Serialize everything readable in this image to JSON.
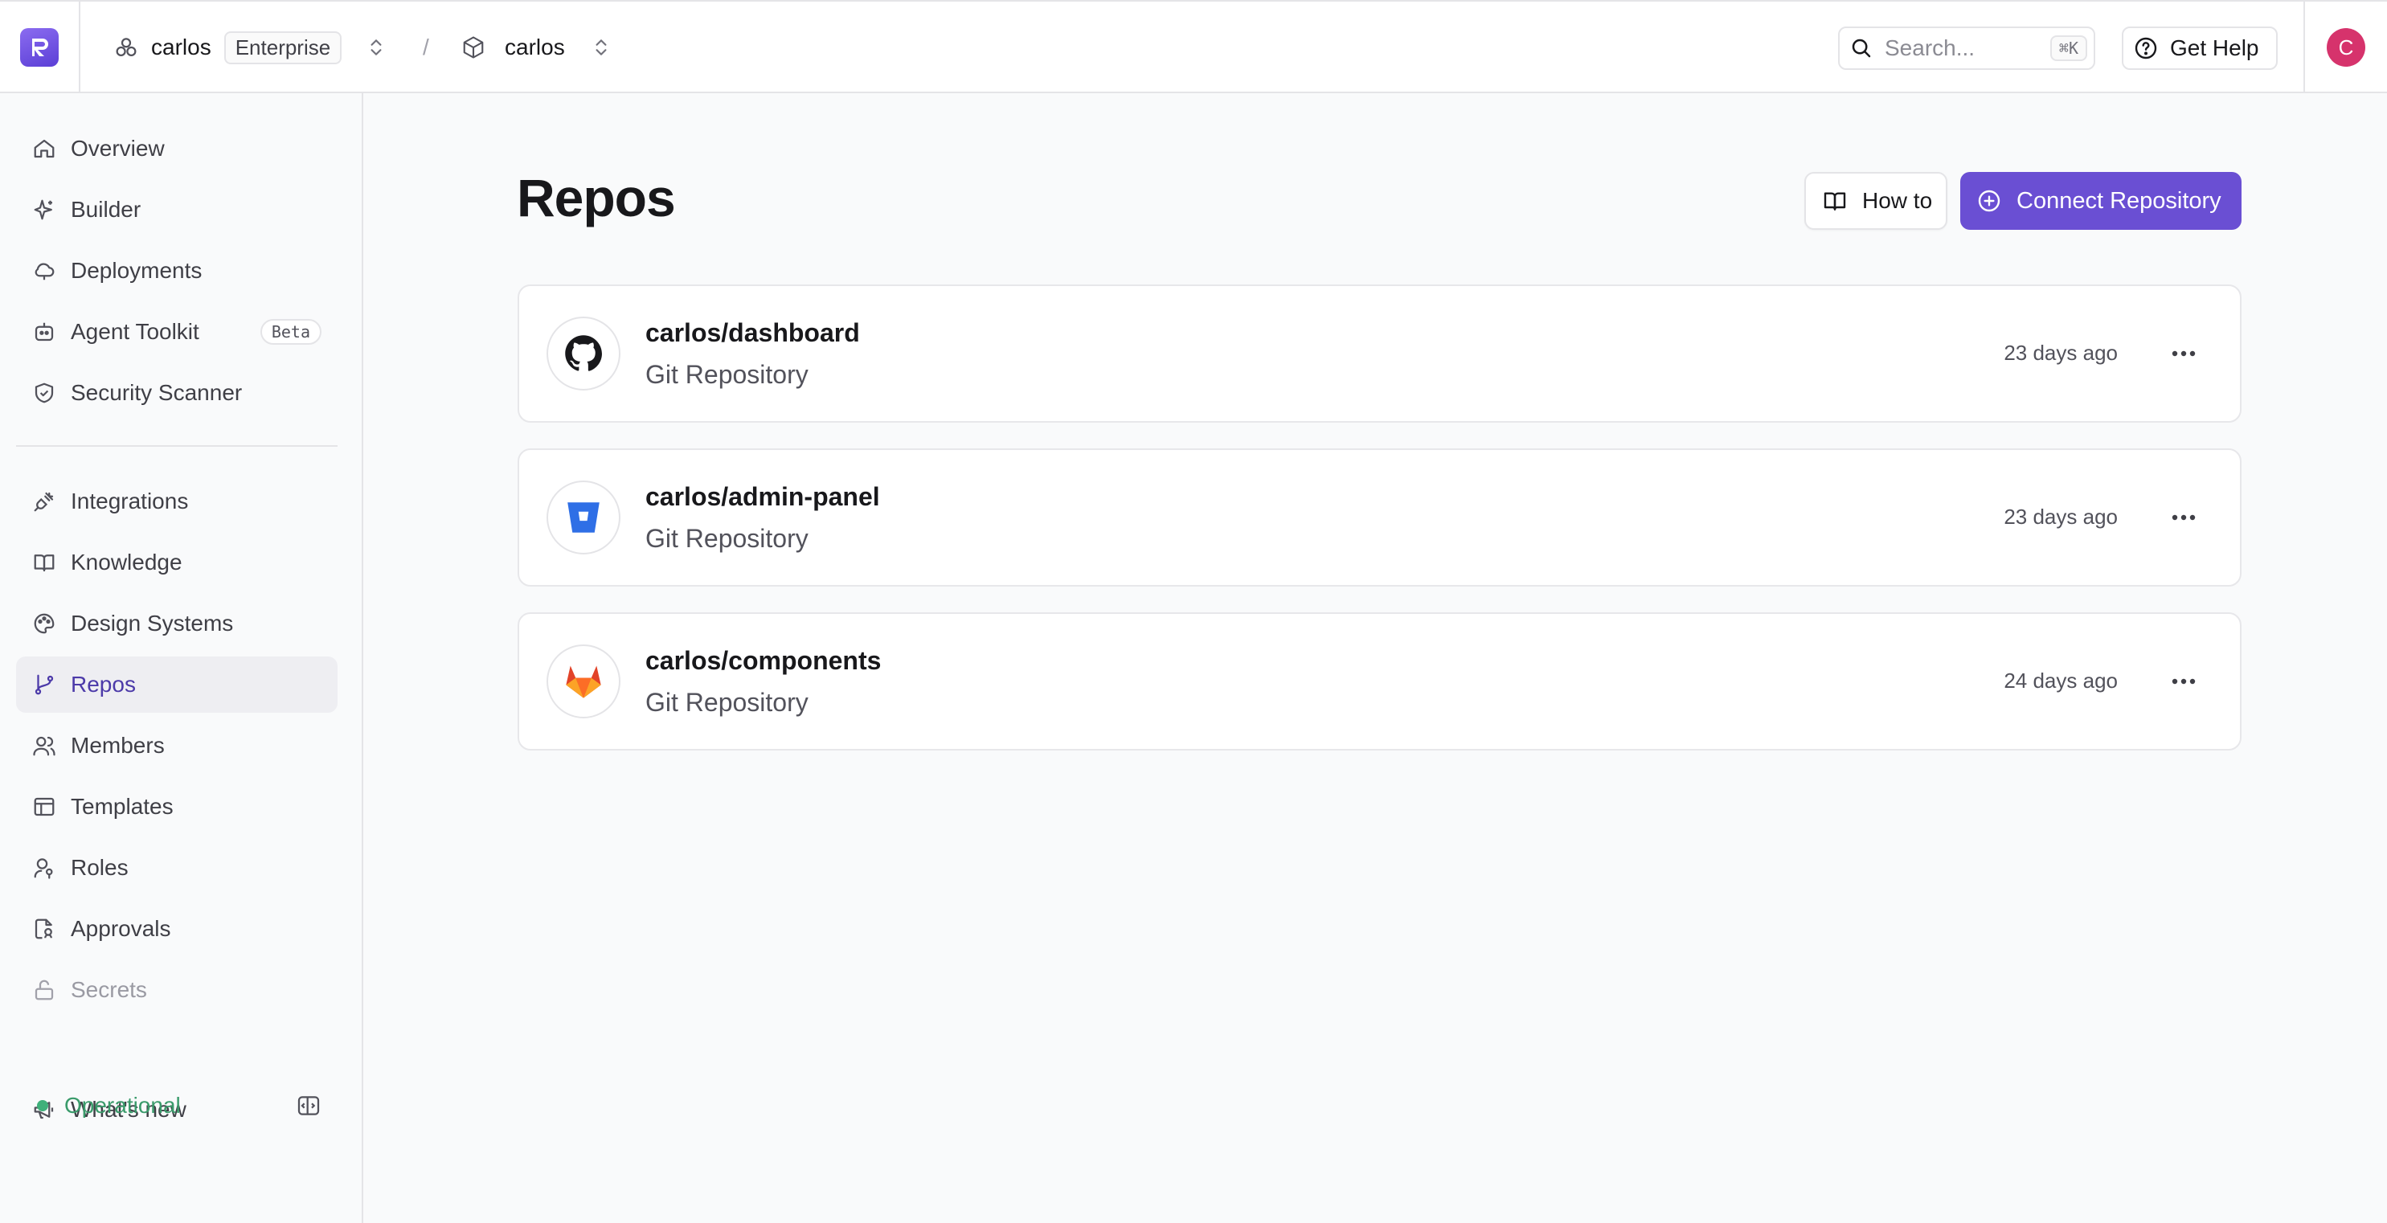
{
  "topbar": {
    "org_name": "carlos",
    "org_plan": "Enterprise",
    "separator": "/",
    "project_name": "carlos",
    "search_placeholder": "Search...",
    "search_shortcut": "⌘K",
    "help_label": "Get Help",
    "avatar_initial": "C"
  },
  "sidebar": {
    "items": [
      {
        "label": "Overview",
        "icon": "home-icon"
      },
      {
        "label": "Builder",
        "icon": "sparkle-icon"
      },
      {
        "label": "Deployments",
        "icon": "cloud-icon"
      },
      {
        "label": "Agent Toolkit",
        "icon": "agent-icon",
        "badge": "Beta"
      },
      {
        "label": "Security Scanner",
        "icon": "shield-icon"
      },
      {
        "label": "Integrations",
        "icon": "plug-icon"
      },
      {
        "label": "Knowledge",
        "icon": "book-icon"
      },
      {
        "label": "Design Systems",
        "icon": "palette-icon"
      },
      {
        "label": "Repos",
        "icon": "git-branch-icon",
        "active": true
      },
      {
        "label": "Members",
        "icon": "users-icon"
      },
      {
        "label": "Templates",
        "icon": "template-icon"
      },
      {
        "label": "Roles",
        "icon": "user-key-icon"
      },
      {
        "label": "Approvals",
        "icon": "approval-icon"
      },
      {
        "label": "Secrets",
        "icon": "lock-icon",
        "muted": true
      }
    ],
    "whats_new": "What's new",
    "status": "Operational"
  },
  "main": {
    "title": "Repos",
    "howto_label": "How to",
    "connect_label": "Connect Repository",
    "repos": [
      {
        "name": "carlos/dashboard",
        "type": "Git Repository",
        "updated": "23 days ago",
        "provider": "github-icon"
      },
      {
        "name": "carlos/admin-panel",
        "type": "Git Repository",
        "updated": "23 days ago",
        "provider": "bitbucket-icon"
      },
      {
        "name": "carlos/components",
        "type": "Git Repository",
        "updated": "24 days ago",
        "provider": "gitlab-icon"
      }
    ]
  },
  "colors": {
    "accent": "#6a4fd3",
    "active_text": "#4c3aa9",
    "status_green": "#3a9b6b",
    "avatar": "#d6336c"
  }
}
